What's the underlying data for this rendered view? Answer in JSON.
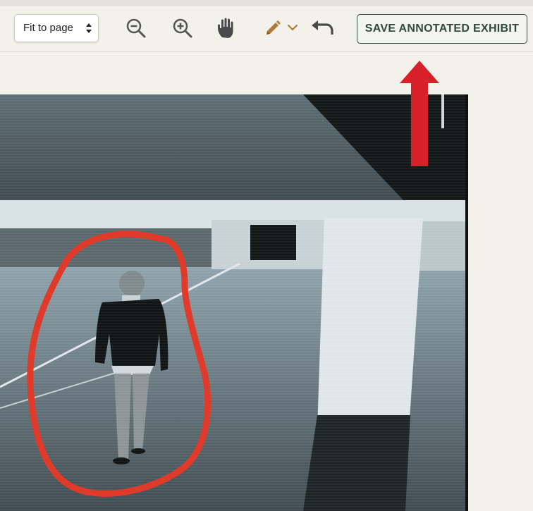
{
  "toolbar": {
    "zoom_select_value": "Fit to page",
    "icons": {
      "zoom_out": "zoom-out-icon",
      "zoom_in": "zoom-in-icon",
      "pan": "hand-icon",
      "draw": "pencil-icon",
      "draw_menu": "chevron-down-icon",
      "undo": "undo-icon"
    },
    "save_label": "SAVE ANNOTATED EXHIBIT"
  },
  "colors": {
    "accent": "#2f4a3b",
    "pencil": "#b07a3a",
    "annotation": "#e03a2a",
    "callout_arrow": "#d7202a"
  }
}
